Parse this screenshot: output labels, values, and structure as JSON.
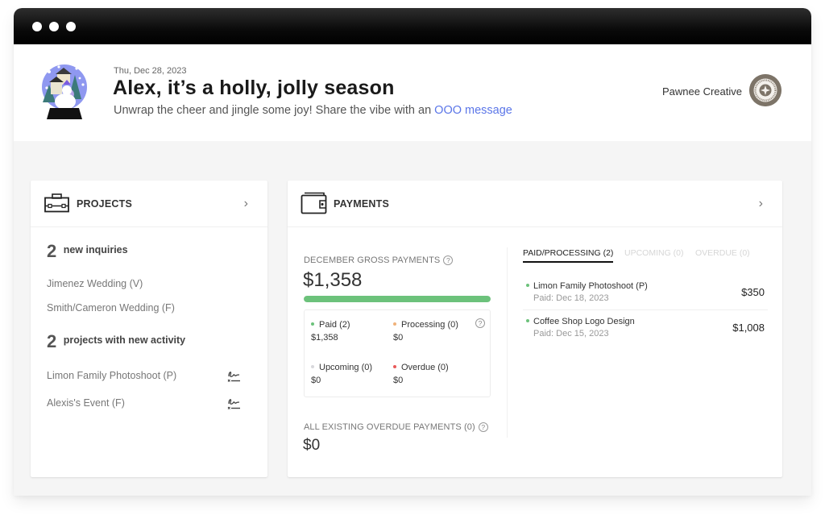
{
  "window": {
    "controls": [
      "dot",
      "dot",
      "dot"
    ]
  },
  "header": {
    "date": "Thu, Dec 28, 2023",
    "title": "Alex, it’s a holly, jolly season",
    "subtitle_prefix": "Unwrap the cheer and jingle some joy! Share the vibe with an ",
    "subtitle_link": "OOO message",
    "company_name": "Pawnee Creative",
    "illustration": "snow-globe-icon",
    "company_logo": "company-seal-logo"
  },
  "projects": {
    "title": "PROJECTS",
    "icon": "briefcase-icon",
    "chevron": "›",
    "inquiries": {
      "count": "2",
      "label": "new inquiries",
      "items": [
        "Jimenez Wedding (V)",
        "Smith/Cameron Wedding (F)"
      ]
    },
    "activity": {
      "count": "2",
      "label": "projects with new activity",
      "items": [
        {
          "name": "Limon Family Photoshoot (P)",
          "icon": "signature-icon"
        },
        {
          "name": "Alexis's Event (F)",
          "icon": "signature-icon"
        }
      ]
    }
  },
  "payments": {
    "title": "PAYMENTS",
    "icon": "wallet-icon",
    "chevron": "›",
    "gross_label": "DECEMBER GROSS PAYMENTS",
    "gross_amount": "$1,358",
    "progress_paid_fraction": 1.0,
    "help": "?",
    "breakdown": [
      {
        "label": "Paid (2)",
        "value": "$1,358",
        "color": "#6cc27b"
      },
      {
        "label": "Processing (0)",
        "value": "$0",
        "color": "#f0b27a"
      },
      {
        "label": "Upcoming (0)",
        "value": "$0",
        "color": "#d8d8dc"
      },
      {
        "label": "Overdue (0)",
        "value": "$0",
        "color": "#e85a5a"
      }
    ],
    "overdue_label": "ALL EXISTING OVERDUE PAYMENTS (0)",
    "overdue_amount": "$0",
    "tabs": [
      {
        "label": "PAID/PROCESSING (2)",
        "active": true
      },
      {
        "label": "UPCOMING (0)",
        "active": false
      },
      {
        "label": "OVERDUE (0)",
        "active": false
      }
    ],
    "list": [
      {
        "name": "Limon Family Photoshoot (P)",
        "date": "Paid: Dec 18, 2023",
        "amount": "$350"
      },
      {
        "name": "Coffee Shop Logo Design",
        "date": "Paid: Dec 15, 2023",
        "amount": "$1,008"
      }
    ]
  },
  "colors": {
    "accent_link": "#5b76e8",
    "paid": "#6cc27b",
    "processing": "#f0b27a",
    "upcoming": "#d8d8dc",
    "overdue": "#e85a5a"
  }
}
